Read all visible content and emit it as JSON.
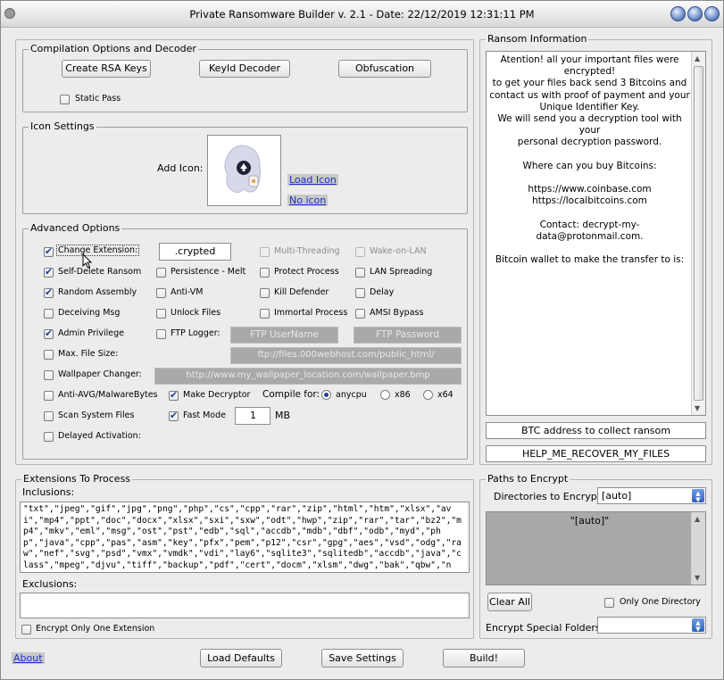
{
  "window": {
    "title": "Private Ransomware Builder v. 2.1 - Date: 22/12/2019 12:31:11 PM"
  },
  "compilation": {
    "title": "Compilation Options and Decoder",
    "create_rsa": "Create RSA Keys",
    "keyid_decoder": "KeyId Decoder",
    "obfuscation": "Obfuscation",
    "static_pass": "Static Pass"
  },
  "icon_settings": {
    "title": "Icon Settings",
    "add_icon": "Add Icon:",
    "load_icon": "Load Icon",
    "no_icon": "No icon"
  },
  "advanced": {
    "title": "Advanced Options",
    "change_extension": "Change Extension:",
    "extension_value": ".crypted",
    "multi_threading": "Multi-Threading",
    "wake_on_lan": "Wake-on-LAN",
    "self_delete": "Self-Delete Ransom",
    "persistence": "Persistence - Melt",
    "protect_process": "Protect Process",
    "lan_spreading": "LAN Spreading",
    "random_assembly": "Random Assembly",
    "anti_vm": "Anti-VM",
    "kill_defender": "Kill Defender",
    "delay": "Delay",
    "deceiving_msg": "Deceiving Msg",
    "unlock_files": "Unlock Files",
    "immortal_process": "Immortal Process",
    "amsi_bypass": "AMSI Bypass",
    "admin_privilege": "Admin Privilege",
    "ftp_logger": "FTP Logger:",
    "ftp_username": "FTP UserName",
    "ftp_password": "FTP Password",
    "max_file_size": "Max. File Size:",
    "ftp_url": "ftp://files.000webhost.com/public_html/",
    "wallpaper_changer": "Wallpaper Changer:",
    "wallpaper_url": "http://www.my_wallpaper_location.com/wallpaper.bmp",
    "anti_avg": "Anti-AVG/MalwareBytes",
    "make_decryptor": "Make Decryptor",
    "compile_for": "Compile for:",
    "anycpu": "anycpu",
    "x86": "x86",
    "x64": "x64",
    "scan_system_files": "Scan System Files",
    "fast_mode": "Fast Mode",
    "size_value": "1",
    "size_unit": "MB",
    "delayed_activation": "Delayed Activation:"
  },
  "ransom": {
    "title": "Ransom Information",
    "lines": [
      "Atention! all your important files were encrypted!",
      "to get your files back send 3 Bitcoins and",
      "contact us with proof of payment and your",
      "Unique Identifier Key.",
      "We will send you a decryption tool with your",
      "personal decryption password.",
      "",
      "Where can you buy Bitcoins:",
      "",
      "https://www.coinbase.com",
      "https://localbitcoins.com",
      "",
      "Contact: decrypt-my-data@protonmail.com.",
      "",
      "Bitcoin wallet to make the transfer to is:"
    ],
    "btc_address": "BTC address to collect ransom",
    "note_name": "HELP_ME_RECOVER_MY_FILES"
  },
  "extensions": {
    "title": "Extensions To Process",
    "inclusions_label": "Inclusions:",
    "inclusions": "\"txt\",\"jpeg\",\"gif\",\"jpg\",\"png\",\"php\",\"cs\",\"cpp\",\"rar\",\"zip\",\"html\",\"htm\",\"xlsx\",\"avi\",\"mp4\",\"ppt\",\"doc\",\"docx\",\"xlsx\",\"sxi\",\"sxw\",\"odt\",\"hwp\",\"zip\",\"rar\",\"tar\",\"bz2\",\"mp4\",\"mkv\",\"eml\",\"msg\",\"ost\",\"pst\",\"edb\",\"sql\",\"accdb\",\"mdb\",\"dbf\",\"odb\",\"myd\",\"php\",\"java\",\"cpp\",\"pas\",\"asm\",\"key\",\"pfx\",\"pem\",\"p12\",\"csr\",\"gpg\",\"aes\",\"vsd\",\"odg\",\"raw\",\"nef\",\"svg\",\"psd\",\"vmx\",\"vmdk\",\"vdi\",\"lay6\",\"sqlite3\",\"sqlitedb\",\"accdb\",\"java\",\"class\",\"mpeg\",\"djvu\",\"tiff\",\"backup\",\"pdf\",\"cert\",\"docm\",\"xlsm\",\"dwg\",\"bak\",\"qbw\",\"nd\",\"tlg\",\"lgb\",\"pptx\",\"mov\",\"xdw\",\"ods\"",
    "exclusions_label": "Exclusions:",
    "exclusions": "",
    "encrypt_one": "Encrypt Only One Extension"
  },
  "paths": {
    "title": "Paths to Encrypt",
    "dirs_label": "Directories to Encrypt:",
    "dirs_value": "[auto]",
    "list_item": "\"[auto]\"",
    "clear_all": "Clear All",
    "only_one_dir": "Only One Directory",
    "special_label": "Encrypt Special Folders:",
    "special_value": ""
  },
  "footer": {
    "about": "About",
    "load_defaults": "Load Defaults",
    "save_settings": "Save Settings",
    "build": "Build!"
  },
  "states": {
    "change_extension": true,
    "self_delete": true,
    "random_assembly": true,
    "admin_privilege": true,
    "make_decryptor": true,
    "fast_mode": true,
    "anycpu": true
  }
}
